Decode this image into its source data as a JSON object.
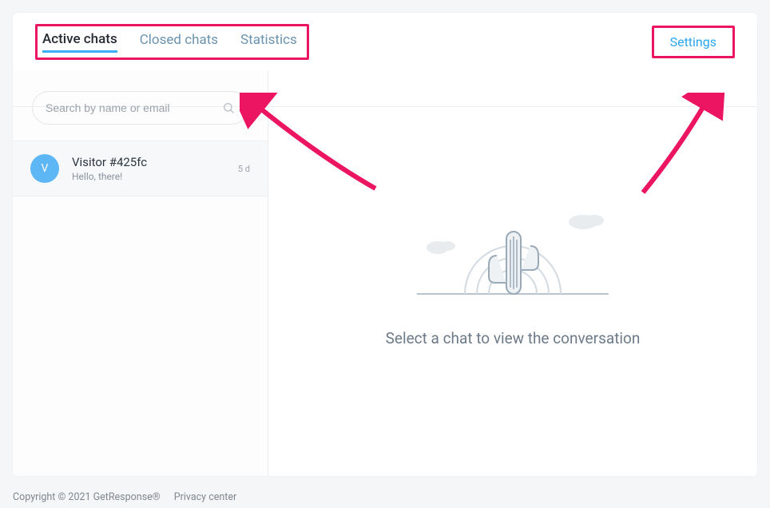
{
  "tabs": {
    "active": "Active chats",
    "closed": "Closed chats",
    "stats": "Statistics"
  },
  "settings_label": "Settings",
  "search": {
    "placeholder": "Search by name or email"
  },
  "chats": [
    {
      "avatar_letter": "V",
      "name": "Visitor #425fc",
      "preview": "Hello, there!",
      "time": "5 d"
    }
  ],
  "empty_state": "Select a chat to view the conversation",
  "footer": {
    "copyright": "Copyright © 2021 GetResponse®",
    "privacy": "Privacy center"
  }
}
